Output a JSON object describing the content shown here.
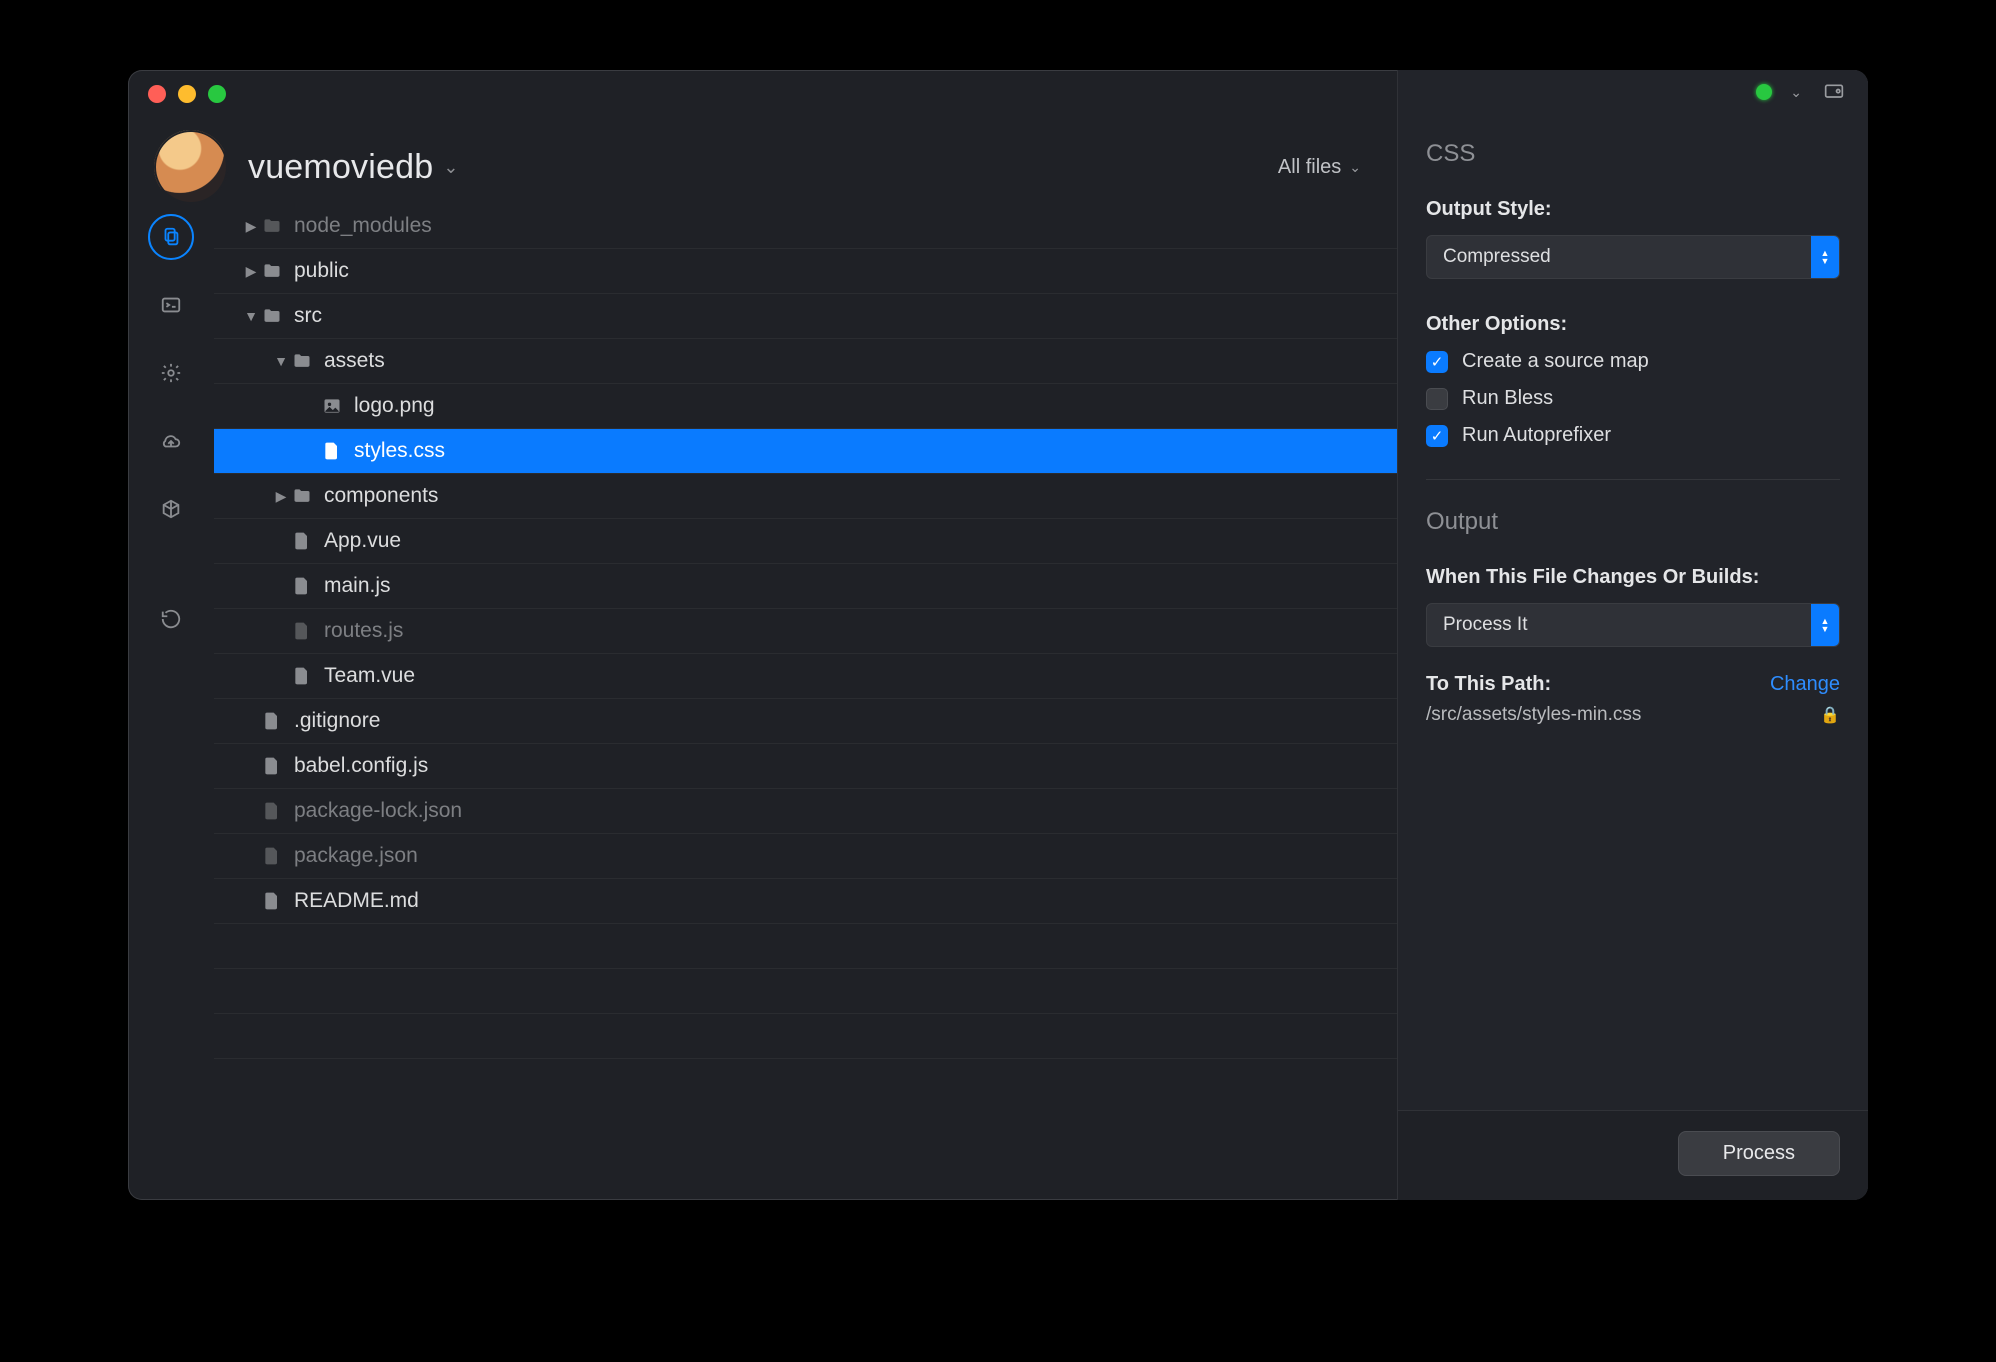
{
  "project": {
    "name": "vuemoviedb"
  },
  "filter_label": "All files",
  "files": [
    {
      "name": "node_modules",
      "type": "folder",
      "depth": 0,
      "arrow": "right",
      "dim": true
    },
    {
      "name": "public",
      "type": "folder",
      "depth": 0,
      "arrow": "right",
      "dim": false
    },
    {
      "name": "src",
      "type": "folder",
      "depth": 0,
      "arrow": "down",
      "dim": false
    },
    {
      "name": "assets",
      "type": "folder",
      "depth": 1,
      "arrow": "down",
      "dim": false
    },
    {
      "name": "logo.png",
      "type": "image",
      "depth": 2,
      "arrow": "",
      "dim": false
    },
    {
      "name": "styles.css",
      "type": "file",
      "depth": 2,
      "arrow": "",
      "dim": false,
      "selected": true
    },
    {
      "name": "components",
      "type": "folder",
      "depth": 1,
      "arrow": "right",
      "dim": false
    },
    {
      "name": "App.vue",
      "type": "file",
      "depth": 1,
      "arrow": "",
      "dim": false
    },
    {
      "name": "main.js",
      "type": "file",
      "depth": 1,
      "arrow": "",
      "dim": false
    },
    {
      "name": "routes.js",
      "type": "file",
      "depth": 1,
      "arrow": "",
      "dim": true
    },
    {
      "name": "Team.vue",
      "type": "file",
      "depth": 1,
      "arrow": "",
      "dim": false
    },
    {
      "name": ".gitignore",
      "type": "file",
      "depth": 0,
      "arrow": "",
      "dim": false
    },
    {
      "name": "babel.config.js",
      "type": "file",
      "depth": 0,
      "arrow": "",
      "dim": false
    },
    {
      "name": "package-lock.json",
      "type": "file",
      "depth": 0,
      "arrow": "",
      "dim": true
    },
    {
      "name": "package.json",
      "type": "file",
      "depth": 0,
      "arrow": "",
      "dim": true
    },
    {
      "name": "README.md",
      "type": "file",
      "depth": 0,
      "arrow": "",
      "dim": false
    }
  ],
  "rail_icons": [
    "files",
    "terminal",
    "settings",
    "cloud",
    "package",
    "refresh"
  ],
  "panel": {
    "section1_title": "CSS",
    "output_style_label": "Output Style:",
    "output_style_value": "Compressed",
    "other_options_label": "Other Options:",
    "opt_source_map": {
      "label": "Create a source map",
      "checked": true
    },
    "opt_run_bless": {
      "label": "Run Bless",
      "checked": false
    },
    "opt_autoprefixer": {
      "label": "Run Autoprefixer",
      "checked": true
    },
    "section2_title": "Output",
    "when_changes_label": "When This File Changes Or Builds:",
    "when_changes_value": "Process It",
    "to_path_label": "To This Path:",
    "change_link": "Change",
    "output_path": "/src/assets/styles-min.css",
    "process_button": "Process"
  }
}
